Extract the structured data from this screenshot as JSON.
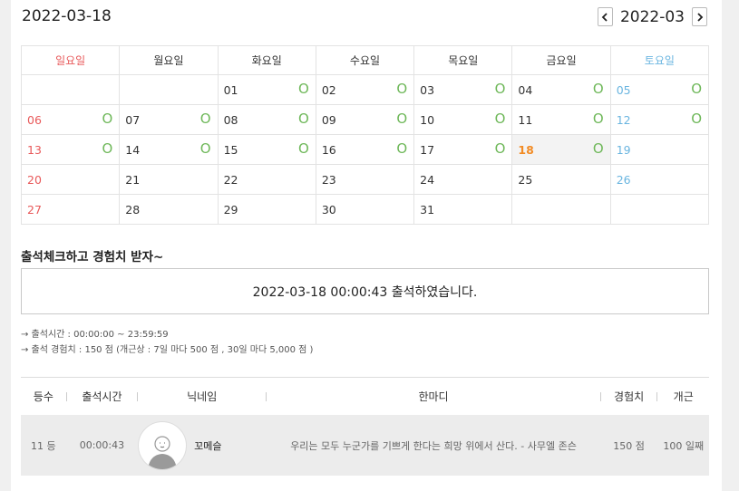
{
  "header": {
    "selected_date": "2022-03-18",
    "month": "2022-03",
    "prev_icon": "chevron-left-icon",
    "next_icon": "chevron-right-icon"
  },
  "calendar": {
    "weekdays": [
      "일요일",
      "월요일",
      "화요일",
      "수요일",
      "목요일",
      "금요일",
      "토요일"
    ],
    "attendance_mark": "O",
    "weeks": [
      [
        "",
        "",
        "01",
        "02",
        "03",
        "04",
        "05"
      ],
      [
        "06",
        "07",
        "08",
        "09",
        "10",
        "11",
        "12"
      ],
      [
        "13",
        "14",
        "15",
        "16",
        "17",
        "18",
        "19"
      ],
      [
        "20",
        "21",
        "22",
        "23",
        "24",
        "25",
        "26"
      ],
      [
        "27",
        "28",
        "29",
        "30",
        "31",
        "",
        ""
      ]
    ],
    "attended_days": [
      "01",
      "02",
      "03",
      "04",
      "05",
      "06",
      "07",
      "08",
      "09",
      "10",
      "11",
      "12",
      "13",
      "14",
      "15",
      "16",
      "17",
      "18"
    ],
    "today": "18",
    "colors": {
      "sunday": "#e8595a",
      "saturday": "#6ab5e0",
      "today": "#f28b24",
      "mark": "#6fb85a"
    }
  },
  "section_title": "출석체크하고 경험치 받자~",
  "status_message": "2022-03-18 00:00:43 출석하였습니다.",
  "info": {
    "time_range": "→ 출석시간 : 00:00:00 ~ 23:59:59",
    "experience": "→ 출석 경험치 : 150 점 (개근상 : 7일 마다 500 점 , 30일 마다 5,000 점 )"
  },
  "ranking": {
    "headers": {
      "rank": "등수",
      "time": "출석시간",
      "nickname": "닉네임",
      "message": "한마디",
      "exp": "경험치",
      "streak": "개근"
    },
    "rows": [
      {
        "rank": "11 등",
        "time": "00:00:43",
        "nickname": "꼬메슬",
        "message": "우리는 모두 누군가를 기쁘게 한다는 희망 위에서 산다. - 사무엘 존슨",
        "exp": "150 점",
        "streak": "100 일째"
      }
    ]
  }
}
